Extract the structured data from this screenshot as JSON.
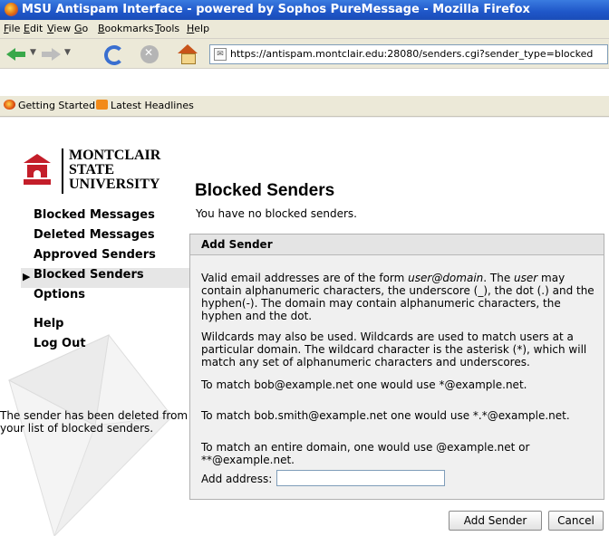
{
  "window": {
    "title": "MSU Antispam Interface - powered by Sophos PureMessage - Mozilla Firefox"
  },
  "menu": [
    "File",
    "Edit",
    "View",
    "Go",
    "Bookmarks",
    "Tools",
    "Help"
  ],
  "url": "https://antispam.montclair.edu:28080/senders.cgi?sender_type=blocked",
  "bookmarks": [
    "Getting Started",
    "Latest Headlines"
  ],
  "logo": {
    "line1": "MONTCLAIR",
    "line2": "STATE",
    "line3": "UNIVERSITY"
  },
  "nav": {
    "items": [
      "Blocked Messages",
      "Deleted Messages",
      "Approved Senders",
      "Blocked Senders",
      "Options"
    ],
    "selected": "Blocked Senders",
    "help": "Help",
    "logout": "Log Out"
  },
  "notice": "The sender has been deleted from your list of blocked senders.",
  "page": {
    "title": "Blocked Senders",
    "status": "You have no blocked senders."
  },
  "panel": {
    "heading": "Add Sender",
    "p1a": "Valid email addresses are of the form ",
    "p1b": "user@domain",
    "p1c": ". The ",
    "p1d": "user",
    "p1e": " may contain alphanumeric characters, the underscore (_), the dot (.) and the hyphen(-). The domain may contain alphanumeric characters, the hyphen and the dot.",
    "p2": "Wildcards may also be used. Wildcards are used to match users at a particular domain. The wildcard character is the asterisk (*), which will match any set of alphanumeric characters and underscores.",
    "p3": "To match bob@example.net one would use *@example.net.",
    "p4": "To match bob.smith@example.net one would use *.*@example.net.",
    "p5": "To match an entire domain, one would use @example.net or **@example.net.",
    "add_label": "Add address:",
    "add_value": ""
  },
  "buttons": {
    "add": "Add Sender",
    "cancel": "Cancel"
  }
}
